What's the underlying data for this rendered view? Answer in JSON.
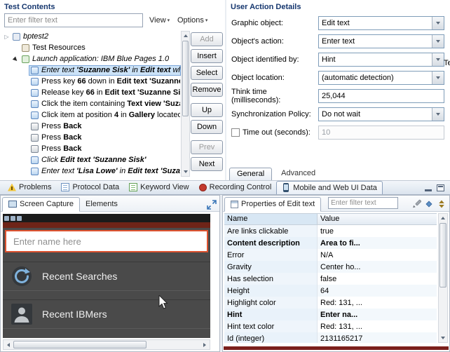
{
  "test_contents": {
    "title": "Test Contents",
    "filter_placeholder": "Enter filter text",
    "view_label": "View",
    "options_label": "Options",
    "side_buttons": [
      {
        "label": "Add",
        "enabled": false
      },
      {
        "label": "Insert",
        "enabled": true
      },
      {
        "label": "Select",
        "enabled": true
      },
      {
        "label": "Remove",
        "enabled": true
      },
      {
        "label": "Up",
        "enabled": true,
        "gap": true
      },
      {
        "label": "Down",
        "enabled": true
      },
      {
        "label": "Prev",
        "enabled": false,
        "gap": true
      },
      {
        "label": "Next",
        "enabled": true
      }
    ],
    "tree": [
      {
        "indent": 0,
        "expander": "collapsed",
        "icon": "test-suite-icon",
        "italic": true,
        "segments": [
          {
            "text": "bptest2"
          }
        ]
      },
      {
        "indent": 1,
        "icon": "test-resources-icon",
        "segments": [
          {
            "text": "Test Resources"
          }
        ]
      },
      {
        "indent": 1,
        "expander": "expanded",
        "icon": "launch-app-icon",
        "italic": true,
        "segments": [
          {
            "text": "Launch application: IBM Blue Pages 1.0"
          }
        ]
      },
      {
        "indent": 2,
        "icon": "step-icon",
        "italic": true,
        "selected": true,
        "segments": [
          {
            "text": "Enter text "
          },
          {
            "text": "'Suzanne Sisk'",
            "bold": true
          },
          {
            "text": " in "
          },
          {
            "text": "Edit text",
            "bold": true
          },
          {
            "text": " whose"
          }
        ]
      },
      {
        "indent": 2,
        "icon": "step-icon",
        "segments": [
          {
            "text": "Press key "
          },
          {
            "text": "66",
            "bold": true
          },
          {
            "text": " down in "
          },
          {
            "text": "Edit text 'Suzanne Sisk",
            "bold": true
          }
        ]
      },
      {
        "indent": 2,
        "icon": "step-icon",
        "segments": [
          {
            "text": "Release key "
          },
          {
            "text": "66",
            "bold": true
          },
          {
            "text": " in "
          },
          {
            "text": "Edit text 'Suzanne Sisk'",
            "bold": true
          }
        ]
      },
      {
        "indent": 2,
        "icon": "step-icon",
        "segments": [
          {
            "text": "Click the item containing "
          },
          {
            "text": "Text view 'Suzanne",
            "bold": true
          }
        ]
      },
      {
        "indent": 2,
        "icon": "step-icon",
        "segments": [
          {
            "text": "Click item at position "
          },
          {
            "text": "4",
            "bold": true
          },
          {
            "text": " in "
          },
          {
            "text": "Gallery",
            "bold": true
          },
          {
            "text": " located a"
          }
        ]
      },
      {
        "indent": 2,
        "icon": "device-icon",
        "segments": [
          {
            "text": "Press "
          },
          {
            "text": "Back",
            "bold": true
          }
        ]
      },
      {
        "indent": 2,
        "icon": "device-icon",
        "segments": [
          {
            "text": "Press "
          },
          {
            "text": "Back",
            "bold": true
          }
        ]
      },
      {
        "indent": 2,
        "icon": "device-icon",
        "segments": [
          {
            "text": "Press "
          },
          {
            "text": "Back",
            "bold": true
          }
        ]
      },
      {
        "indent": 2,
        "icon": "step-icon",
        "italic": true,
        "segments": [
          {
            "text": "Click "
          },
          {
            "text": "Edit text 'Suzanne Sisk'",
            "bold": true
          }
        ]
      },
      {
        "indent": 2,
        "icon": "step-icon",
        "italic": true,
        "segments": [
          {
            "text": "Enter text "
          },
          {
            "text": "'Lisa Lowe'",
            "bold": true
          },
          {
            "text": " in "
          },
          {
            "text": "Edit text 'Suzanne",
            "bold": true
          }
        ]
      }
    ]
  },
  "user_action_details": {
    "title": "User Action Details",
    "clipped_label": "Te",
    "fields": [
      {
        "label": "Graphic object:",
        "value": "Edit text",
        "control": "select"
      },
      {
        "label": "Object's action:",
        "value": "Enter text",
        "control": "select"
      },
      {
        "label": "Object identified by:",
        "value": "Hint",
        "control": "select"
      },
      {
        "label": "Object location:",
        "value": "(automatic detection)",
        "control": "select"
      },
      {
        "label": "Think time (milliseconds):",
        "value": "25,044",
        "control": "text"
      },
      {
        "label": "Synchronization Policy:",
        "value": "Do not wait",
        "control": "select"
      },
      {
        "label": "Time out (seconds):",
        "value": "10",
        "control": "text",
        "disabled": true,
        "checkbox": true
      }
    ],
    "tabs": [
      {
        "label": "General",
        "selected": true
      },
      {
        "label": "Advanced",
        "selected": false
      }
    ]
  },
  "bottom_tabs": [
    {
      "label": "Problems",
      "icon": "problems-icon",
      "selected": false
    },
    {
      "label": "Protocol Data",
      "icon": "protocol-data-icon",
      "selected": false
    },
    {
      "label": "Keyword View",
      "icon": "keyword-view-icon",
      "selected": false
    },
    {
      "label": "Recording Control",
      "icon": "recording-control-icon",
      "selected": false
    },
    {
      "label": "Mobile and Web UI Data",
      "icon": "mobile-icon",
      "selected": true
    }
  ],
  "screen_capture": {
    "tabs": [
      {
        "label": "Screen Capture",
        "selected": true
      },
      {
        "label": "Elements",
        "selected": false
      }
    ],
    "capture": {
      "input_text": "Enter name here",
      "list_items": [
        {
          "label": "Recent Searches",
          "icon": "recent-searches-icon"
        },
        {
          "label": "Recent IBMers",
          "icon": "recent-ibmers-icon"
        }
      ]
    }
  },
  "properties": {
    "title": "Properties of Edit text",
    "filter_placeholder": "Enter filter text",
    "columns": [
      "Name",
      "Value"
    ],
    "rows": [
      {
        "name": "Are links clickable",
        "value": "true"
      },
      {
        "name": "Content description",
        "value": "Area to fi...",
        "bold": true
      },
      {
        "name": "Error",
        "value": "N/A"
      },
      {
        "name": "Gravity",
        "value": "Center ho..."
      },
      {
        "name": "Has selection",
        "value": "false"
      },
      {
        "name": "Height",
        "value": "64"
      },
      {
        "name": "Highlight color",
        "value": "Red: 131, ..."
      },
      {
        "name": "Hint",
        "value": "Enter na...",
        "bold": true
      },
      {
        "name": "Hint text color",
        "value": "Red: 131, ..."
      },
      {
        "name": "Id (integer)",
        "value": "2131165217"
      }
    ]
  },
  "colors": {
    "selection_bg": "#cbe2f7",
    "capture_highlight_border": "#de5330",
    "accent_maroon": "#7a1f1c"
  }
}
